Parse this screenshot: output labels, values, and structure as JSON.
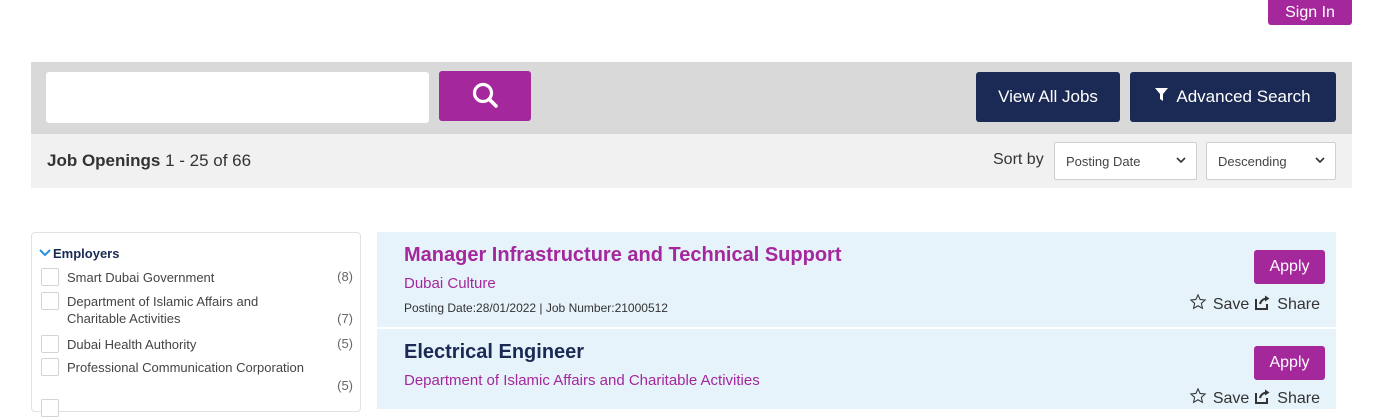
{
  "header": {
    "sign_in_label": "Sign In"
  },
  "search": {
    "input_value": "",
    "search_icon": "magnifier-icon",
    "view_all_label": "View All Jobs",
    "advanced_label": "Advanced Search",
    "advanced_icon": "filter-icon"
  },
  "results": {
    "label": "Job Openings",
    "range": "1 - 25 of 66",
    "sort_label": "Sort by",
    "sort_field": "Posting Date",
    "sort_order": "Descending"
  },
  "facets": {
    "title": "Employers",
    "items": [
      {
        "label": "Smart Dubai Government",
        "count": "(8)"
      },
      {
        "label": "Department of Islamic Affairs and Charitable Activities",
        "count": "(7)"
      },
      {
        "label": "Dubai Health Authority",
        "count": "(5)"
      },
      {
        "label": "Professional Communication Corporation",
        "count": "(5)"
      }
    ]
  },
  "jobs": [
    {
      "title": "Manager Infrastructure and Technical Support",
      "employer": "Dubai Culture",
      "meta": "Posting Date:28/01/2022 | Job Number:21000512",
      "apply_label": "Apply",
      "save_label": "Save",
      "share_label": "Share"
    },
    {
      "title": "Electrical Engineer",
      "employer": "Department of Islamic Affairs and Charitable Activities",
      "meta": "",
      "apply_label": "Apply",
      "save_label": "Save",
      "share_label": "Share"
    }
  ],
  "colors": {
    "brand_purple": "#a4279c",
    "navy": "#1b2a55",
    "card_bg": "#e6f3fb",
    "toolbar_bg": "#d9d9d9"
  }
}
